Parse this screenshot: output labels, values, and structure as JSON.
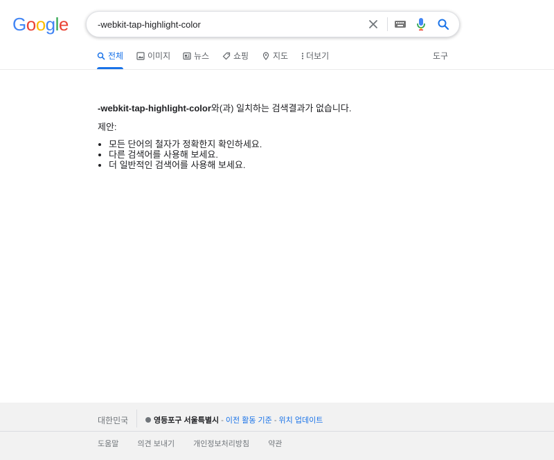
{
  "logo": {
    "letters": [
      "G",
      "o",
      "o",
      "g",
      "l",
      "e"
    ],
    "colors": [
      "#4285F4",
      "#EA4335",
      "#FBBC05",
      "#4285F4",
      "#34A853",
      "#EA4335"
    ]
  },
  "search": {
    "value": "-webkit-tap-highlight-color"
  },
  "tabs": [
    {
      "label": "전체",
      "icon": "search-icon"
    },
    {
      "label": "이미지",
      "icon": "image-icon"
    },
    {
      "label": "뉴스",
      "icon": "news-icon"
    },
    {
      "label": "쇼핑",
      "icon": "tag-icon"
    },
    {
      "label": "지도",
      "icon": "map-pin-icon"
    },
    {
      "label": "더보기",
      "icon": "more-vert-icon"
    }
  ],
  "tools_label": "도구",
  "result": {
    "query": "-webkit-tap-highlight-color",
    "no_match_suffix": "와(과) 일치하는 검색결과가 없습니다.",
    "suggest_label": "제안:",
    "suggestions": [
      "모든 단어의 철자가 정확한지 확인하세요.",
      "다른 검색어를 사용해 보세요.",
      "더 일반적인 검색어를 사용해 보세요."
    ]
  },
  "footer": {
    "country": "대한민국",
    "location": "영등포구 서울특별시",
    "sep1": " - ",
    "history_link": "이전 활동 기준",
    "sep2": " - ",
    "update_link": "위치 업데이트",
    "links": [
      "도움말",
      "의견 보내기",
      "개인정보처리방침",
      "약관"
    ]
  },
  "colors": {
    "accent": "#1a73e8",
    "footer_bg": "#f2f2f2"
  }
}
